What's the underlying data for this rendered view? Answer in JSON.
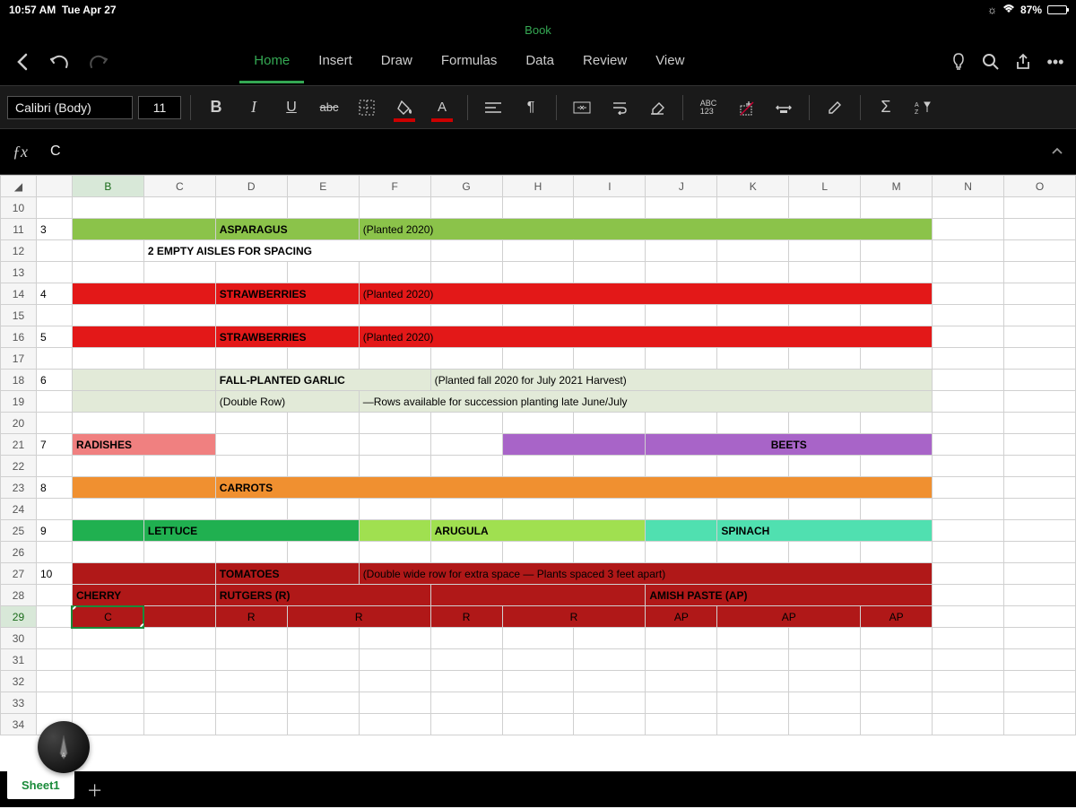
{
  "status": {
    "time": "10:57 AM",
    "date": "Tue Apr 27",
    "battery": "87%"
  },
  "doc_title": "Book",
  "tabs": {
    "home": "Home",
    "insert": "Insert",
    "draw": "Draw",
    "formulas": "Formulas",
    "data": "Data",
    "review": "Review",
    "view": "View"
  },
  "ribbon": {
    "font": "Calibri (Body)",
    "size": "11",
    "bold": "B",
    "italic": "I",
    "underline": "U",
    "strike": "abc",
    "abc123": "ABC\n123",
    "sigma": "Σ"
  },
  "formula": {
    "fx": "ƒx",
    "value": "C"
  },
  "columns": [
    "B",
    "C",
    "D",
    "E",
    "F",
    "G",
    "H",
    "I",
    "J",
    "K",
    "L",
    "M",
    "N",
    "O"
  ],
  "row_headers": [
    "10",
    "11",
    "12",
    "13",
    "14",
    "15",
    "16",
    "17",
    "18",
    "19",
    "20",
    "21",
    "22",
    "23",
    "24",
    "25",
    "26",
    "27",
    "28",
    "29",
    "30",
    "31",
    "32",
    "33",
    "34"
  ],
  "cells": {
    "r11": {
      "A": "3",
      "D": "ASPARAGUS",
      "F": "(Planted 2020)"
    },
    "r12": {
      "C": "2 EMPTY AISLES FOR SPACING"
    },
    "r14": {
      "A": "4",
      "D": "STRAWBERRIES",
      "F": "(Planted 2020)"
    },
    "r16": {
      "A": "5",
      "D": "STRAWBERRIES",
      "F": "(Planted 2020)"
    },
    "r18": {
      "A": "6",
      "D": "FALL-PLANTED GARLIC",
      "G": "(Planted fall 2020 for July 2021 Harvest)"
    },
    "r19": {
      "D": "(Double Row)",
      "F": "—Rows available for succession planting late June/July"
    },
    "r21": {
      "A": "7",
      "B": "RADISHES",
      "J": "BEETS"
    },
    "r23": {
      "A": "8",
      "D": "CARROTS"
    },
    "r25": {
      "A": "9",
      "C": "LETTUCE",
      "G": "ARUGULA",
      "K": "SPINACH"
    },
    "r27": {
      "A": "10",
      "D": "TOMATOES",
      "F": "(Double wide row for extra space — Plants spaced 3 feet apart)"
    },
    "r28": {
      "B": "CHERRY",
      "D": "RUTGERS (R)",
      "J": "AMISH PASTE (AP)"
    },
    "r29": {
      "B": "C",
      "D": "R",
      "E": "R",
      "G": "R",
      "H": "R",
      "J": "AP",
      "K": "AP",
      "M": "AP"
    }
  },
  "colors": {
    "asparagus": "#8bc34a",
    "straw": "#e31818",
    "garlic": "#e2ead8",
    "radish": "#f08080",
    "beets": "#a864c8",
    "carrots": "#f09030",
    "lettuce": "#20b050",
    "arugula": "#a0e050",
    "spinach": "#50e0b0",
    "tomato": "#b01818"
  },
  "sheet": {
    "name": "Sheet1"
  }
}
